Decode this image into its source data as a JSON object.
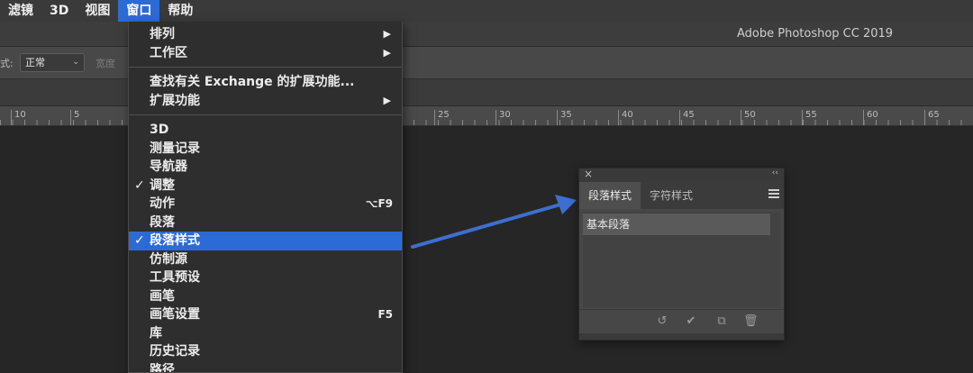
{
  "menubar": {
    "items": [
      {
        "label": "滤镜",
        "active": false
      },
      {
        "label": "3D",
        "active": false
      },
      {
        "label": "视图",
        "active": false
      },
      {
        "label": "窗口",
        "active": true
      },
      {
        "label": "帮助",
        "active": false
      }
    ]
  },
  "app": {
    "title": "Adobe Photoshop CC 2019"
  },
  "options_bar": {
    "style_label": "式:",
    "style_value": "正常",
    "width_label": "宽度"
  },
  "ruler": {
    "labels": [
      "10",
      "5",
      "25",
      "30",
      "35",
      "40",
      "45",
      "50",
      "55",
      "60",
      "65"
    ]
  },
  "window_menu": {
    "group1": [
      {
        "label": "排列",
        "submenu": true
      },
      {
        "label": "工作区",
        "submenu": true
      }
    ],
    "group2": [
      {
        "label": "查找有关 Exchange 的扩展功能...",
        "submenu": false
      },
      {
        "label": "扩展功能",
        "submenu": true
      }
    ],
    "group3": [
      {
        "label": "3D",
        "checked": false,
        "shortcut": "",
        "selected": false
      },
      {
        "label": "测量记录",
        "checked": false,
        "shortcut": "",
        "selected": false
      },
      {
        "label": "导航器",
        "checked": false,
        "shortcut": "",
        "selected": false
      },
      {
        "label": "调整",
        "checked": true,
        "shortcut": "",
        "selected": false
      },
      {
        "label": "动作",
        "checked": false,
        "shortcut": "⌥F9",
        "selected": false
      },
      {
        "label": "段落",
        "checked": false,
        "shortcut": "",
        "selected": false
      },
      {
        "label": "段落样式",
        "checked": true,
        "shortcut": "",
        "selected": true
      },
      {
        "label": "仿制源",
        "checked": false,
        "shortcut": "",
        "selected": false
      },
      {
        "label": "工具预设",
        "checked": false,
        "shortcut": "",
        "selected": false
      },
      {
        "label": "画笔",
        "checked": false,
        "shortcut": "",
        "selected": false
      },
      {
        "label": "画笔设置",
        "checked": false,
        "shortcut": "F5",
        "selected": false
      },
      {
        "label": "库",
        "checked": false,
        "shortcut": "",
        "selected": false
      },
      {
        "label": "历史记录",
        "checked": false,
        "shortcut": "",
        "selected": false
      },
      {
        "label": "路径",
        "checked": false,
        "shortcut": "",
        "selected": false
      }
    ],
    "check_glyph": "✓",
    "arrow_glyph": "▶"
  },
  "panel": {
    "close_glyph": "×",
    "collapse_glyph": "‹‹",
    "tabs": [
      {
        "label": "段落样式",
        "active": true
      },
      {
        "label": "字符样式",
        "active": false
      }
    ],
    "list": [
      "基本段落"
    ],
    "footer_icons": [
      "clear-override-icon",
      "redefine-checkmark-icon",
      "new-style-icon",
      "trash-icon"
    ]
  },
  "colors": {
    "accent": "#2c6bd6",
    "arrow": "#3d6fd0"
  }
}
